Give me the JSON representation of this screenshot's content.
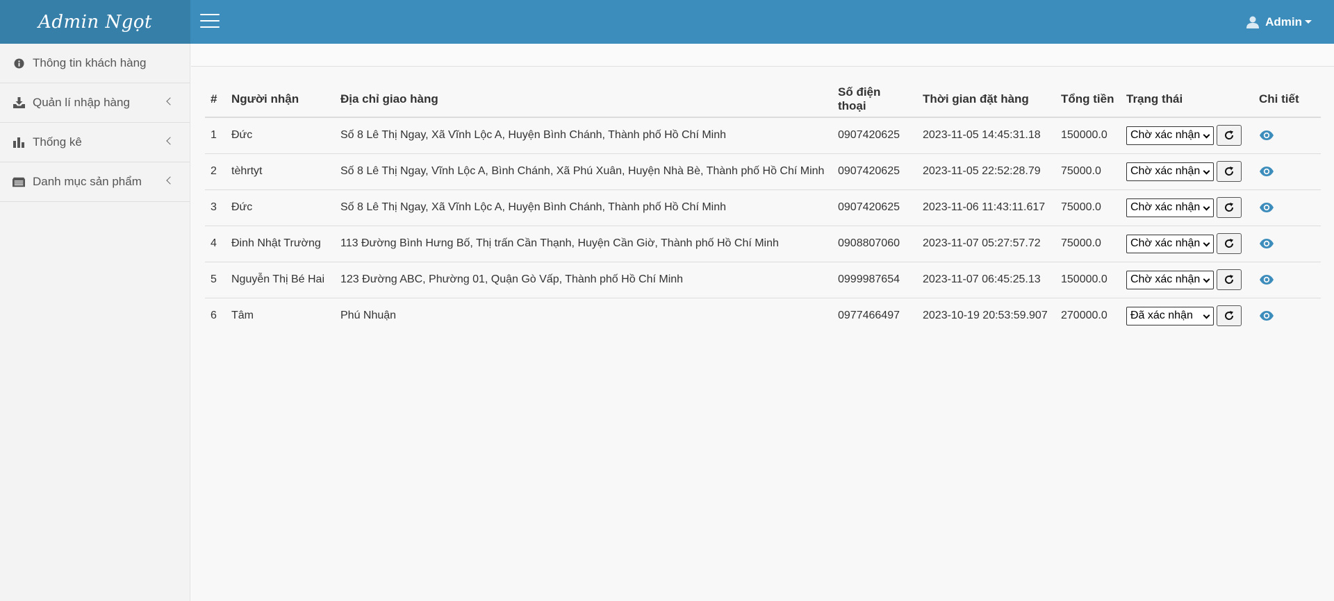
{
  "header": {
    "brand": "Admin Ngọt",
    "user": "Admin"
  },
  "sidebar": {
    "items": [
      {
        "label": "Thông tin khách hàng",
        "icon": "info-circle-icon",
        "has_submenu": false
      },
      {
        "label": "Quản lí nhập hàng",
        "icon": "download-icon",
        "has_submenu": true
      },
      {
        "label": "Thống kê",
        "icon": "bar-chart-icon",
        "has_submenu": true
      },
      {
        "label": "Danh mục sản phẩm",
        "icon": "list-box-icon",
        "has_submenu": true
      }
    ]
  },
  "table": {
    "headers": {
      "index": "#",
      "receiver": "Người nhận",
      "address": "Địa chỉ giao hàng",
      "phone": "Số điện thoại",
      "time": "Thời gian đặt hàng",
      "total": "Tổng tiền",
      "status": "Trạng thái",
      "detail": "Chi tiết"
    },
    "rows": [
      {
        "index": "1",
        "receiver": "Đức",
        "address": "Số 8 Lê Thị Ngay, Xã Vĩnh Lộc A, Huyện Bình Chánh, Thành phố Hồ Chí Minh",
        "phone": "0907420625",
        "time": "2023-11-05 14:45:31.18",
        "total": "150000.0",
        "status": "Chờ xác nhận"
      },
      {
        "index": "2",
        "receiver": "tèhrtyt",
        "address": "Số 8 Lê Thị Ngay, Vĩnh Lộc A, Bình Chánh, Xã Phú Xuân, Huyện Nhà Bè, Thành phố Hồ Chí Minh",
        "phone": "0907420625",
        "time": "2023-11-05 22:52:28.79",
        "total": "75000.0",
        "status": "Chờ xác nhận"
      },
      {
        "index": "3",
        "receiver": "Đức",
        "address": "Số 8 Lê Thị Ngay, Xã Vĩnh Lộc A, Huyện Bình Chánh, Thành phố Hồ Chí Minh",
        "phone": "0907420625",
        "time": "2023-11-06 11:43:11.617",
        "total": "75000.0",
        "status": "Chờ xác nhận"
      },
      {
        "index": "4",
        "receiver": "Đinh Nhật Trường",
        "address": "113 Đường Bình Hưng Bố, Thị trấn Cần Thạnh, Huyện Cần Giờ, Thành phố Hồ Chí Minh",
        "phone": "0908807060",
        "time": "2023-11-07 05:27:57.72",
        "total": "75000.0",
        "status": "Chờ xác nhận"
      },
      {
        "index": "5",
        "receiver": "Nguyễn Thị Bé Hai",
        "address": "123 Đường ABC, Phường 01, Quận Gò Vấp, Thành phố Hồ Chí Minh",
        "phone": "0999987654",
        "time": "2023-11-07 06:45:25.13",
        "total": "150000.0",
        "status": "Chờ xác nhận"
      },
      {
        "index": "6",
        "receiver": "Tâm",
        "address": "Phú Nhuận",
        "phone": "0977466497",
        "time": "2023-10-19 20:53:59.907",
        "total": "270000.0",
        "status": "Đã xác nhận"
      }
    ]
  },
  "colors": {
    "header_bg": "#3c8dbc",
    "brand_bg": "#367fa9",
    "eye_icon": "#3c8dbc"
  }
}
